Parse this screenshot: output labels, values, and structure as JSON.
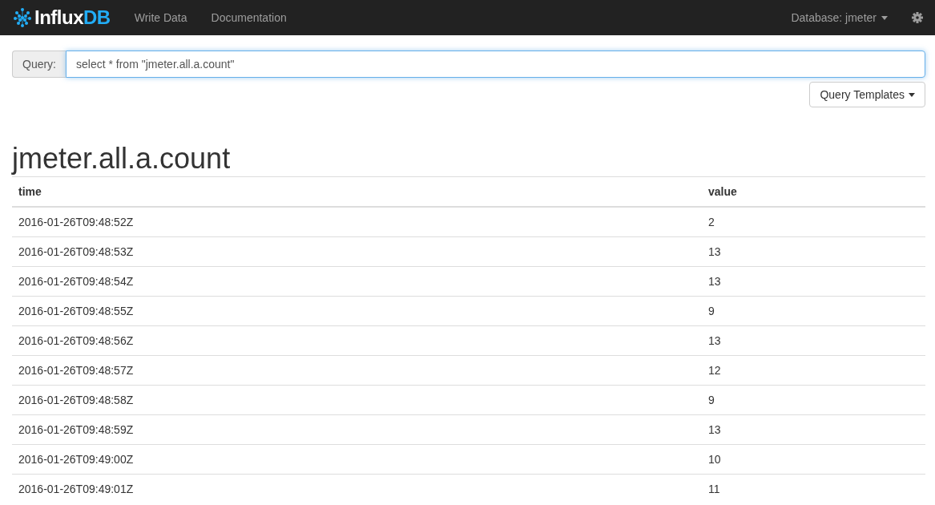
{
  "navbar": {
    "logo": {
      "main": "Influx",
      "accent": "DB"
    },
    "links": [
      "Write Data",
      "Documentation"
    ],
    "database_menu": "Database: jmeter"
  },
  "query": {
    "label": "Query:",
    "value": "select * from \"jmeter.all.a.count\"",
    "templates_button": "Query Templates"
  },
  "series": {
    "title": "jmeter.all.a.count",
    "columns": [
      "time",
      "value"
    ],
    "rows": [
      [
        "2016-01-26T09:48:52Z",
        "2"
      ],
      [
        "2016-01-26T09:48:53Z",
        "13"
      ],
      [
        "2016-01-26T09:48:54Z",
        "13"
      ],
      [
        "2016-01-26T09:48:55Z",
        "9"
      ],
      [
        "2016-01-26T09:48:56Z",
        "13"
      ],
      [
        "2016-01-26T09:48:57Z",
        "12"
      ],
      [
        "2016-01-26T09:48:58Z",
        "9"
      ],
      [
        "2016-01-26T09:48:59Z",
        "13"
      ],
      [
        "2016-01-26T09:49:00Z",
        "10"
      ],
      [
        "2016-01-26T09:49:01Z",
        "11"
      ]
    ]
  }
}
